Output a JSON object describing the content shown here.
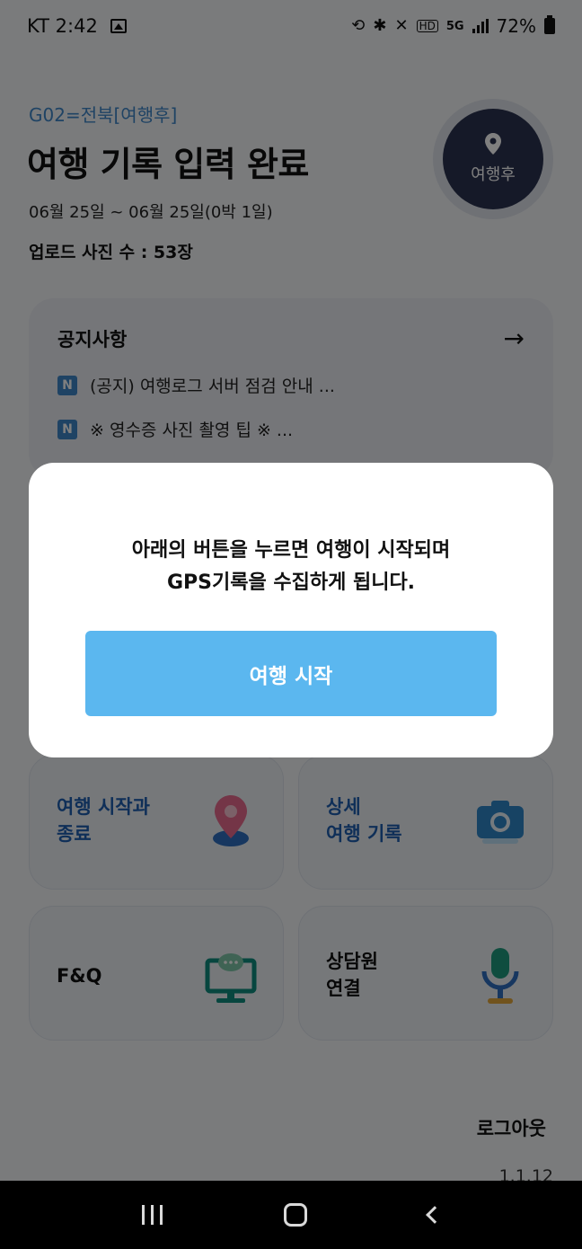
{
  "status_bar": {
    "carrier_time": "KT 2:42",
    "network": "5G",
    "battery": "72%"
  },
  "header": {
    "region": "G02=전북[여행후]",
    "title": "여행 기록 입력 완료",
    "period": "06월 25일 ~ 06월 25일(0박 1일)",
    "upload_count": "업로드 사진 수 : 53장",
    "status_badge": "여행후"
  },
  "notice": {
    "title": "공지사항",
    "items": [
      {
        "badge": "N",
        "text": "(공지) 여행로그 서버 점검 안내  ..."
      },
      {
        "badge": "N",
        "text": "※ 영수증 사진 촬영 팁 ※ ..."
      }
    ]
  },
  "menu": {
    "tiles": [
      {
        "line1": "여행 시작과",
        "line2": "종료",
        "icon": "map-pin-icon"
      },
      {
        "line1": "상세",
        "line2": "여행 기록",
        "icon": "camera-icon"
      },
      {
        "line1": "F&Q",
        "line2": "",
        "icon": "monitor-chat-icon"
      },
      {
        "line1": "상담원",
        "line2": "연결",
        "icon": "microphone-icon"
      }
    ]
  },
  "footer": {
    "logout": "로그아웃",
    "version": "1.1.12"
  },
  "modal": {
    "message_line1": "아래의 버튼을 누르면 여행이 시작되며",
    "message_line2": "GPS기록을 수집하게 됩니다.",
    "button_label": "여행 시작"
  },
  "colors": {
    "accent_blue": "#3f86c9",
    "button_blue": "#5bb7ef",
    "badge_navy": "#2b3350"
  }
}
